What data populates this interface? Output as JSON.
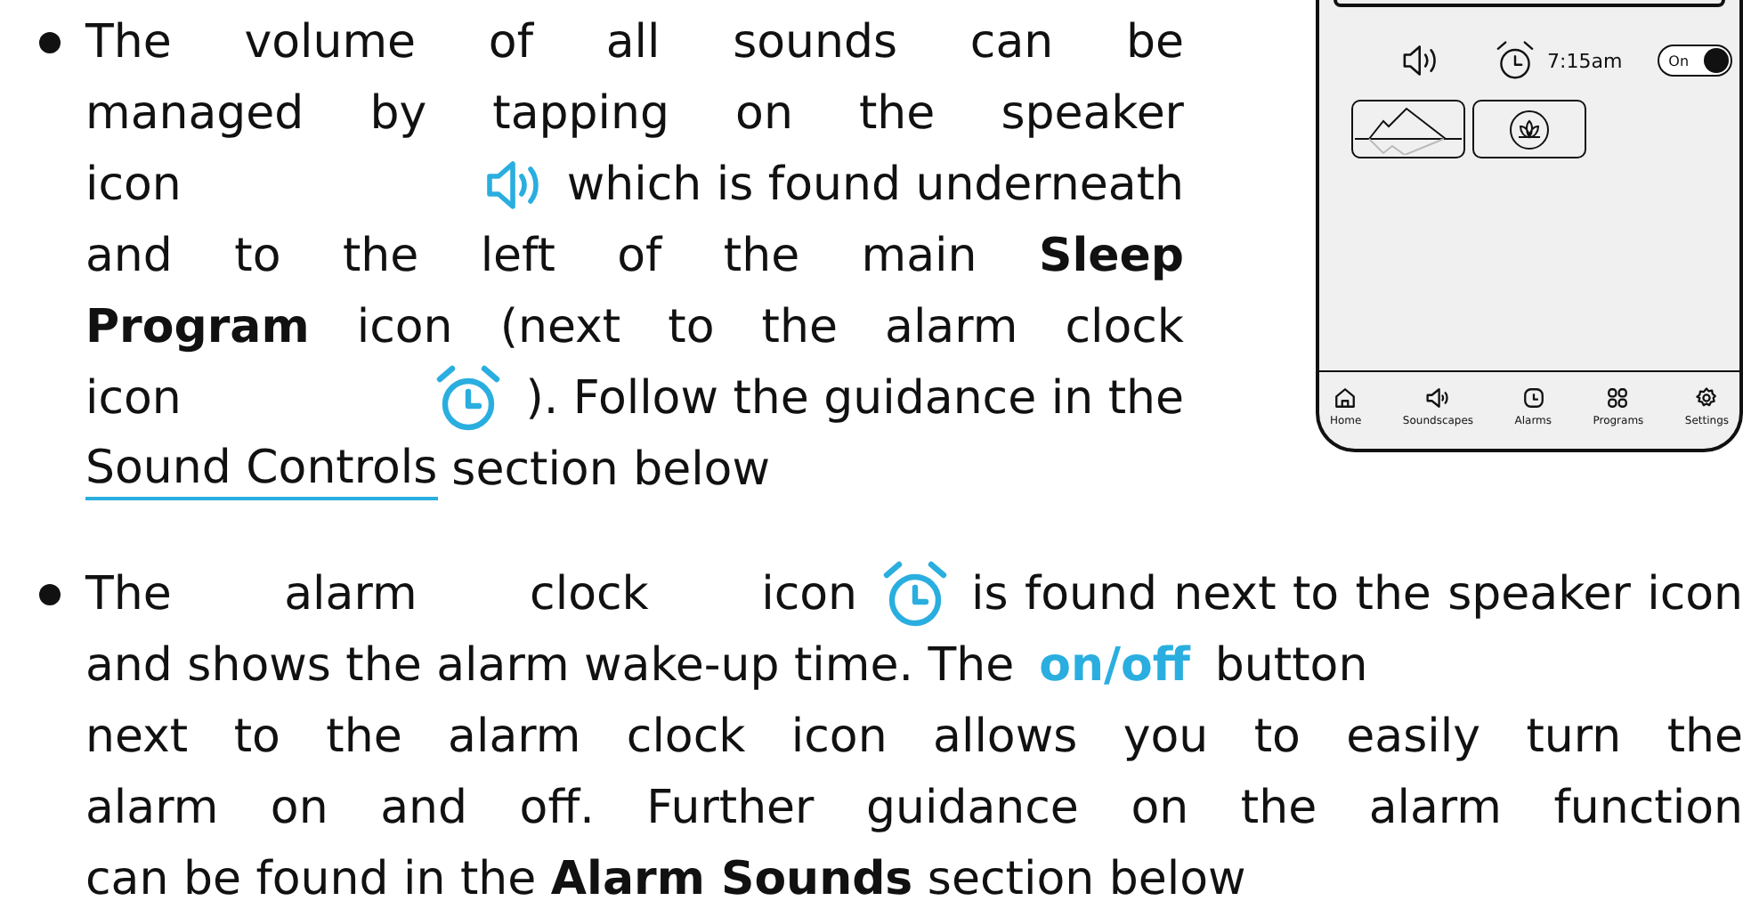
{
  "bullets": [
    {
      "lines": [
        [
          {
            "kind": "text",
            "text": "The volume of all sounds can be"
          }
        ],
        [
          {
            "kind": "text",
            "text": "managed by tapping on the speaker"
          }
        ],
        [
          {
            "kind": "text",
            "text": "icon"
          },
          {
            "kind": "speaker"
          },
          {
            "kind": "text",
            "text": "which is found underneath"
          }
        ],
        [
          {
            "kind": "text",
            "text": "and to the left of the main **Sleep**"
          }
        ],
        [
          {
            "kind": "text",
            "text": "**Program** icon (next to the alarm clock"
          }
        ],
        [
          {
            "kind": "text",
            "text": "icon"
          },
          {
            "kind": "alarm"
          },
          {
            "kind": "text",
            "text": "). Follow the guidance in the"
          }
        ],
        [
          {
            "kind": "link",
            "text": "Sound Controls"
          },
          {
            "kind": "text",
            "text": "section below"
          }
        ]
      ]
    },
    {
      "lines": [
        [
          {
            "kind": "text",
            "text": "The alarm clock icon"
          },
          {
            "kind": "alarm"
          },
          {
            "kind": "text",
            "text": "is found next to the speaker icon"
          }
        ],
        [
          {
            "kind": "text",
            "text": "and shows the alarm wake-up time. The"
          },
          {
            "kind": "highlight",
            "text": "on/off"
          },
          {
            "kind": "text",
            "text": "button"
          }
        ],
        [
          {
            "kind": "text",
            "text": "next to the alarm clock icon allows you to easily turn the"
          }
        ],
        [
          {
            "kind": "text",
            "text": "alarm on and off. Further guidance on the alarm function"
          }
        ],
        [
          {
            "kind": "text",
            "text": "can be found in the **Alarm Sounds** section below"
          }
        ]
      ]
    }
  ],
  "phone": {
    "alarm_time": "7:15am",
    "toggle": {
      "label": "On",
      "on": true
    },
    "nav": [
      {
        "label": "Home"
      },
      {
        "label": "Soundscapes"
      },
      {
        "label": "Alarms"
      },
      {
        "label": "Programs"
      },
      {
        "label": "Settings"
      }
    ]
  }
}
